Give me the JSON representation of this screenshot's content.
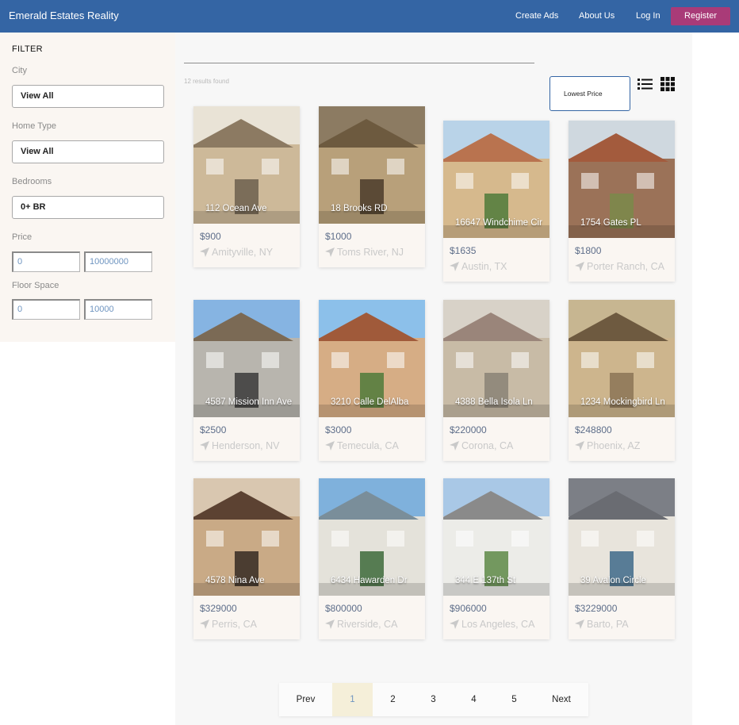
{
  "header": {
    "brand": "Emerald Estates Reality",
    "nav": [
      "Create Ads",
      "About Us",
      "Log In"
    ],
    "register": "Register"
  },
  "filter": {
    "title": "FILTER",
    "city_label": "City",
    "city_value": "View All",
    "home_type_label": "Home Type",
    "home_type_value": "View All",
    "bedrooms_label": "Bedrooms",
    "bedrooms_value": "0+ BR",
    "price_label": "Price",
    "price_min": "0",
    "price_max": "10000000",
    "floor_label": "Floor Space",
    "floor_min": "0",
    "floor_max": "10000"
  },
  "results": {
    "count_text": "12 results found",
    "sort_value": "Lowest Price"
  },
  "listings": [
    {
      "address": "112 Ocean Ave",
      "price": "$900",
      "location": "Amityville, NY"
    },
    {
      "address": "18 Brooks RD",
      "price": "$1000",
      "location": "Toms River, NJ"
    },
    {
      "address": "16647 Windchime Cir",
      "price": "$1635",
      "location": "Austin, TX"
    },
    {
      "address": "1754 Gates PL",
      "price": "$1800",
      "location": "Porter Ranch, CA"
    },
    {
      "address": "4587 Mission Inn Ave",
      "price": "$2500",
      "location": "Henderson, NV"
    },
    {
      "address": "3210 Calle DelAlba",
      "price": "$3000",
      "location": "Temecula, CA"
    },
    {
      "address": "4388 Bella Isola Ln",
      "price": "$220000",
      "location": "Corona, CA"
    },
    {
      "address": "1234 Mockingbird Ln",
      "price": "$248800",
      "location": "Phoenix, AZ"
    },
    {
      "address": "4578 Nina Ave",
      "price": "$329000",
      "location": "Perris, CA"
    },
    {
      "address": "6434 Hawarden Dr",
      "price": "$800000",
      "location": "Riverside, CA"
    },
    {
      "address": "344 E 137th St",
      "price": "$906000",
      "location": "Los Angeles, CA"
    },
    {
      "address": "39 Avalon Circle",
      "price": "$3229000",
      "location": "Barto, PA"
    }
  ],
  "pagination": {
    "prev": "Prev",
    "pages": [
      "1",
      "2",
      "3",
      "4",
      "5"
    ],
    "next": "Next",
    "current": "1"
  },
  "colors": {
    "header": "#3465a4",
    "register": "#a93b78",
    "card_bg": "#faf6f2",
    "price": "#5e6e8a"
  },
  "icons": {
    "location": "location-arrow-icon",
    "list_view": "list-view-icon",
    "grid_view": "grid-view-icon"
  }
}
